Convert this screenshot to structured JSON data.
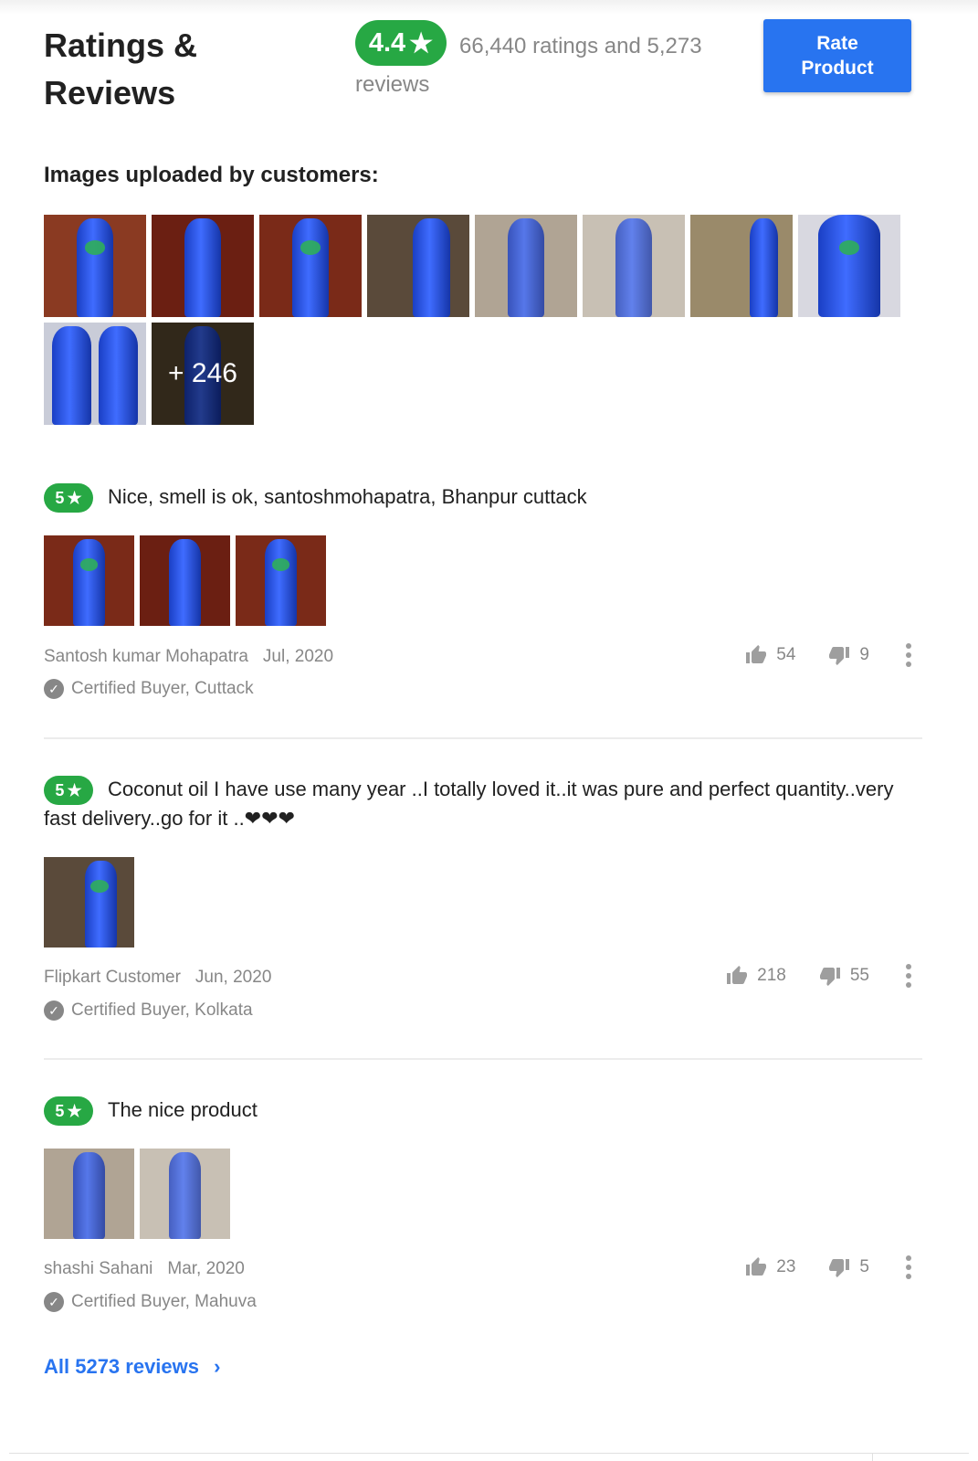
{
  "header": {
    "title": "Ratings & Reviews",
    "rating": "4.4",
    "star": "★",
    "rating_summary": "66,440 ratings and 5,273 reviews",
    "rate_button": "Rate Product"
  },
  "customer_images": {
    "heading": "Images uploaded by customers:",
    "more_count": "+ 246"
  },
  "reviews": [
    {
      "rating": "5",
      "text": "Nice, smell is ok, santoshmohapatra, Bhanpur cuttack",
      "author": "Santosh kumar Mohapatra",
      "date": "Jul, 2020",
      "certified": "Certified Buyer, Cuttack",
      "likes": "54",
      "dislikes": "9"
    },
    {
      "rating": "5",
      "text": "Coconut oil I have use many year ..I totally loved it..it was pure and perfect quantity..very fast delivery..go for it ..❤❤❤",
      "author": "Flipkart Customer",
      "date": "Jun, 2020",
      "certified": "Certified Buyer, Kolkata",
      "likes": "218",
      "dislikes": "55"
    },
    {
      "rating": "5",
      "text": "The nice product",
      "author": "shashi Sahani",
      "date": "Mar, 2020",
      "certified": "Certified Buyer, Mahuva",
      "likes": "23",
      "dislikes": "5"
    }
  ],
  "footer": {
    "all_reviews": "All 5273 reviews",
    "chevron": "›"
  },
  "colors": {
    "rating_green": "#27a844",
    "primary_blue": "#2874f0",
    "muted_text": "#878787"
  },
  "icons": [
    "star-icon",
    "thumbs-up-icon",
    "thumbs-down-icon",
    "more-vert-icon",
    "check-circle-icon",
    "chevron-right-icon"
  ]
}
